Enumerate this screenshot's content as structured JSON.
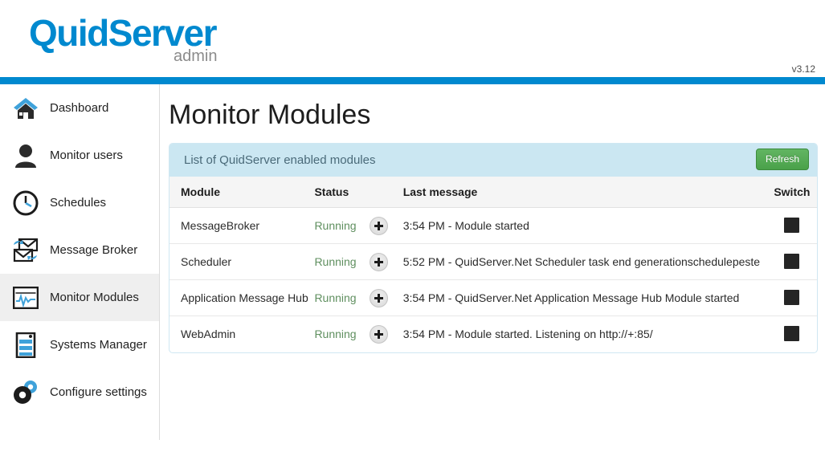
{
  "header": {
    "brand_main": "QuidServer",
    "brand_sub": "admin",
    "version": "v3.12",
    "brand_color": "#0089cf"
  },
  "sidebar": {
    "items": [
      {
        "label": "Dashboard",
        "icon": "home-icon",
        "active": false
      },
      {
        "label": "Monitor users",
        "icon": "user-icon",
        "active": false
      },
      {
        "label": "Schedules",
        "icon": "clock-icon",
        "active": false
      },
      {
        "label": "Message Broker",
        "icon": "envelope-sync-icon",
        "active": false
      },
      {
        "label": "Monitor Modules",
        "icon": "monitor-pulse-icon",
        "active": true
      },
      {
        "label": "Systems Manager",
        "icon": "server-rack-icon",
        "active": false
      },
      {
        "label": "Configure settings",
        "icon": "gears-icon",
        "active": false
      }
    ]
  },
  "main": {
    "page_title": "Monitor Modules",
    "panel": {
      "title": "List of QuidServer enabled modules",
      "refresh_label": "Refresh",
      "header_color": "#cbe7f2",
      "refresh_color": "#4aa14a"
    },
    "table": {
      "columns": [
        "Module",
        "Status",
        "Last message",
        "Switch"
      ],
      "rows": [
        {
          "module": "MessageBroker",
          "status": "Running",
          "message": "3:54 PM - Module started",
          "switch": "stop"
        },
        {
          "module": "Scheduler",
          "status": "Running",
          "message": "5:52 PM - QuidServer.Net Scheduler task end generationschedulepeste",
          "switch": "stop"
        },
        {
          "module": "Application Message Hub",
          "status": "Running",
          "message": "3:54 PM - QuidServer.Net Application Message Hub Module started",
          "switch": "stop"
        },
        {
          "module": "WebAdmin",
          "status": "Running",
          "message": "3:54 PM - Module started. Listening on http://+:85/",
          "switch": "stop"
        }
      ]
    }
  }
}
